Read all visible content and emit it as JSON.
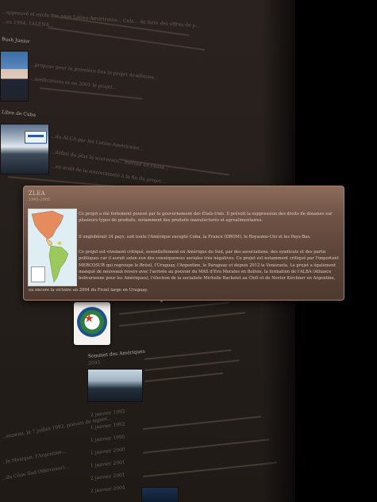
{
  "background": {
    "top_lines": [
      "...approuvé et exclu des pays Latino-Américains... Cela... de faire des offres de p...",
      "...en 1994, l'ALENA..."
    ],
    "heading_bush": "Bush Junior",
    "bush_lines": [
      "...propose pour la première fois le projet Acadimies...",
      "...médications et en 2001 le projet..."
    ],
    "heading_cuba": "Libre de Cuba",
    "cuba_lines": [
      "...du ALCA par les Latino-Américains...",
      "...défini du plus la souverain... mettait en cause...",
      "...en avait de la souveraineté à la fin du projet..."
    ],
    "heading_sommet": "Sommet des Amériques",
    "heading_sommet_year": "2005",
    "date_items": [
      "2 janvier 1992",
      "1 janvier 1992",
      "1 janvier 1995",
      "1 janvier 2000",
      "1 janvier 2001",
      "2 janvier 2001",
      "2 janvier 2004"
    ],
    "left_bottom_lines": [
      "...ennemi, le 7 juillet 1992, prévoit de signer...",
      "...le Mexique, l'Argentine...",
      "...du Cône Sud (Mercosur)..."
    ]
  },
  "popup": {
    "title": "ZLEA",
    "years": "1995-2005",
    "map_icon": "americas-map-image",
    "paragraph1": "Ce projet a été fortement poussé par le gouvernement des États-Unis. Il prévoit la suppression des droits de douanes sur plusieurs types de produits, notamment des produits manufacturés et agroalimentaires.",
    "paragraph2": "Il englobérait 34 pays, soit toute l'Amérique excepté Cuba, la France (DROM), le Royaume-Uni et les Pays-Bas.",
    "paragraph3": "Ce projet est vivement critiqué, essentiellement en Amérique du Sud, par des associations, des syndicats et des partis politiques car il aurait selon eux des conséquences sociales très négatives. Ce projet est notamment critiqué par l'important MERCOSUR qui regroupe le Brésil, l'Uruguay, l'Argentine, le Paraguay et depuis 2012 le Venezuela. Le projet a également manqué de nouveaux revers avec l'arrivée au pouvoir du MAS d'Evo Morales en Bolivie, la formation de l'ALBA (Alliance bolivarienne pour les Amériques), l'élection de la socialiste Michelle Bachelet au Chili et de Nestor Kirchner en Argentine,",
    "paragraph4": "ou encore la victoire en 2004 du Front large en Uruguay."
  },
  "colors": {
    "popup_top": "#8b6a5a",
    "popup_bottom": "#4f3a30",
    "page_background": "#2a221e",
    "outside": "#000000"
  }
}
